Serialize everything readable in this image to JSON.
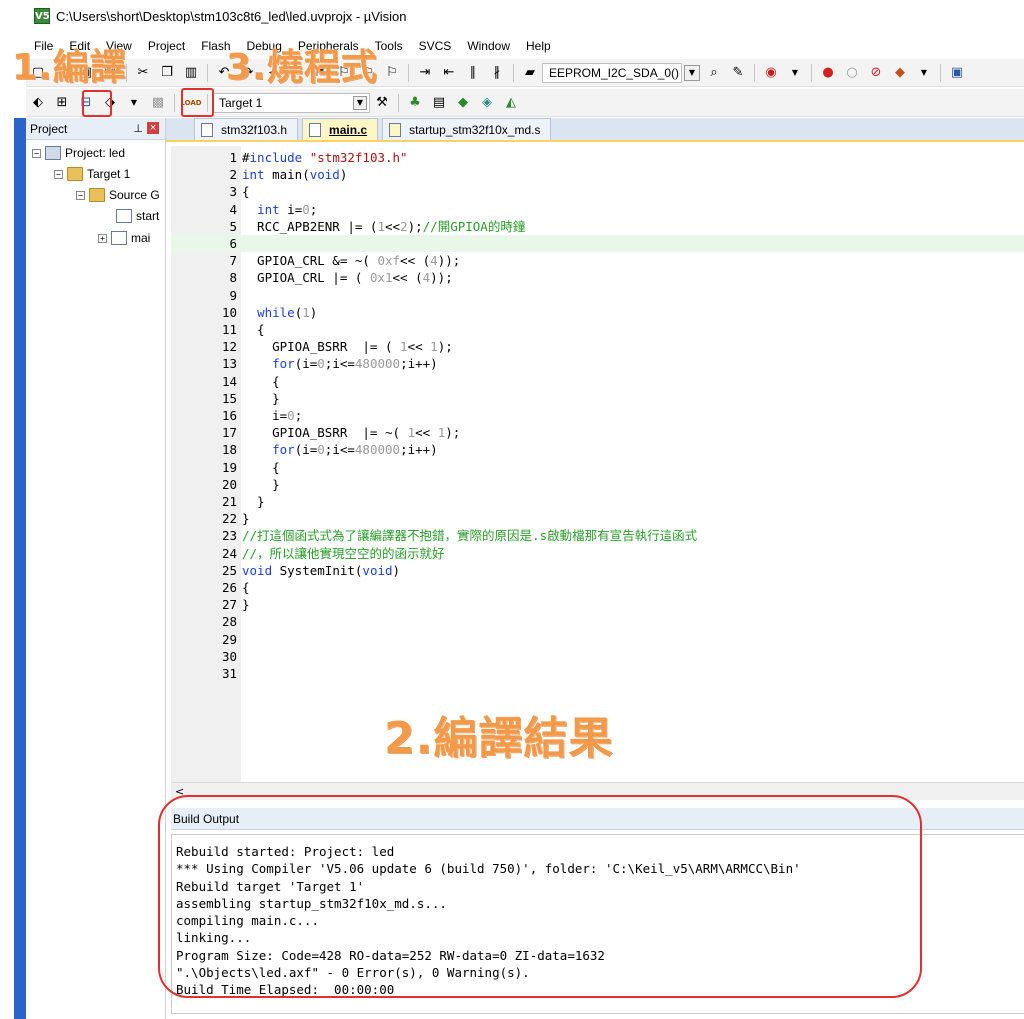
{
  "window": {
    "app_icon": "V5",
    "title": "C:\\Users\\short\\Desktop\\stm103c8t6_led\\led.uvprojx - µVision"
  },
  "menu": [
    "File",
    "Edit",
    "View",
    "Project",
    "Flash",
    "Debug",
    "Peripherals",
    "Tools",
    "SVCS",
    "Window",
    "Help"
  ],
  "toolbar1": {
    "combo_value": "EEPROM_I2C_SDA_0()"
  },
  "toolbar2": {
    "target_value": "Target 1",
    "load_label": "LOAD"
  },
  "project_panel": {
    "title": "Project",
    "items": [
      {
        "label": "Project: led"
      },
      {
        "label": "Target 1"
      },
      {
        "label": "Source G"
      },
      {
        "label": "start"
      },
      {
        "label": "mai"
      }
    ]
  },
  "tabs": [
    {
      "label": "stm32f103.h",
      "active": false
    },
    {
      "label": "main.c",
      "active": true
    },
    {
      "label": "startup_stm32f10x_md.s",
      "active": false
    }
  ],
  "code_lines": [
    "#include \"stm32f103.h\"",
    "int main(void)",
    "{",
    "  int i=0;",
    "  RCC_APB2ENR |= (1<<2);//開GPIOA的時鐘",
    "",
    "  GPIOA_CRL &= ~( 0xf<< (4));",
    "  GPIOA_CRL |= ( 0x1<< (4));",
    "",
    "  while(1)",
    "  {",
    "    GPIOA_BSRR  |= ( 1<< 1);",
    "    for(i=0;i<=480000;i++)",
    "    {",
    "    }",
    "    i=0;",
    "    GPIOA_BSRR  |= ~( 1<< 1);",
    "    for(i=0;i<=480000;i++)",
    "    {",
    "    }",
    "  }",
    "}",
    "//打這個函式式為了讓編譯器不抱錯，實際的原因是.s啟動檔那有宣告執行這函式",
    "//，所以讓他實現空空的的函示就好",
    "void SystemInit(void)",
    "{",
    "}",
    "",
    "",
    "",
    ""
  ],
  "current_line": 6,
  "build_output": {
    "title": "Build Output",
    "lines": [
      "Rebuild started: Project: led",
      "*** Using Compiler 'V5.06 update 6 (build 750)', folder: 'C:\\Keil_v5\\ARM\\ARMCC\\Bin'",
      "Rebuild target 'Target 1'",
      "assembling startup_stm32f10x_md.s...",
      "compiling main.c...",
      "linking...",
      "Program Size: Code=428 RO-data=252 RW-data=0 ZI-data=1632",
      "\".\\Objects\\led.axf\" - 0 Error(s), 0 Warning(s).",
      "Build Time Elapsed:  00:00:00"
    ]
  },
  "annotations": {
    "compile": "1.編譯",
    "build_result": "2.編譯結果",
    "burn": "3.燒程式"
  },
  "colors": {
    "annotation": "#f39a4a",
    "highlight": "#e03030",
    "keyword": "#1f3fd0",
    "comment": "#2d9a2d",
    "string": "#a31515",
    "current_line": "#e8f7e8"
  }
}
